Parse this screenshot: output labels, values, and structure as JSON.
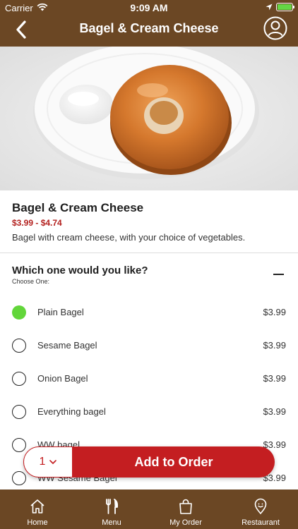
{
  "status_bar": {
    "carrier": "Carrier",
    "time": "9:09 AM",
    "battery_charge": 1.0,
    "battery_color": "#64d644"
  },
  "nav": {
    "title": "Bagel & Cream Cheese",
    "back_icon": "chevron-left-icon",
    "profile_icon": "user-circle-icon",
    "background": "#6b4724"
  },
  "item": {
    "name": "Bagel & Cream Cheese",
    "price_range": "$3.99 - $4.74",
    "description": "Bagel with cream cheese, with your choice of vegetables.",
    "price_color": "#b3201e"
  },
  "option_group": {
    "title": "Which one would you like?",
    "subtitle": "Choose One:",
    "options": [
      {
        "label": "Plain Bagel",
        "price": "$3.99",
        "selected": true
      },
      {
        "label": "Sesame Bagel",
        "price": "$3.99",
        "selected": false
      },
      {
        "label": "Onion Bagel",
        "price": "$3.99",
        "selected": false
      },
      {
        "label": "Everything bagel",
        "price": "$3.99",
        "selected": false
      },
      {
        "label": "WW bagel",
        "price": "$3.99",
        "selected": false
      },
      {
        "label": "WW Sesame Bagel",
        "price": "$3.99",
        "selected": false
      }
    ],
    "selected_color": "#62d63a"
  },
  "order": {
    "quantity": "1",
    "button_label": "Add to Order",
    "accent": "#c41e21"
  },
  "tabs": [
    {
      "label": "Home",
      "icon": "home-icon"
    },
    {
      "label": "Menu",
      "icon": "fork-knife-icon"
    },
    {
      "label": "My Order",
      "icon": "shopping-bag-icon"
    },
    {
      "label": "Restaurant",
      "icon": "location-pin-icon"
    }
  ]
}
